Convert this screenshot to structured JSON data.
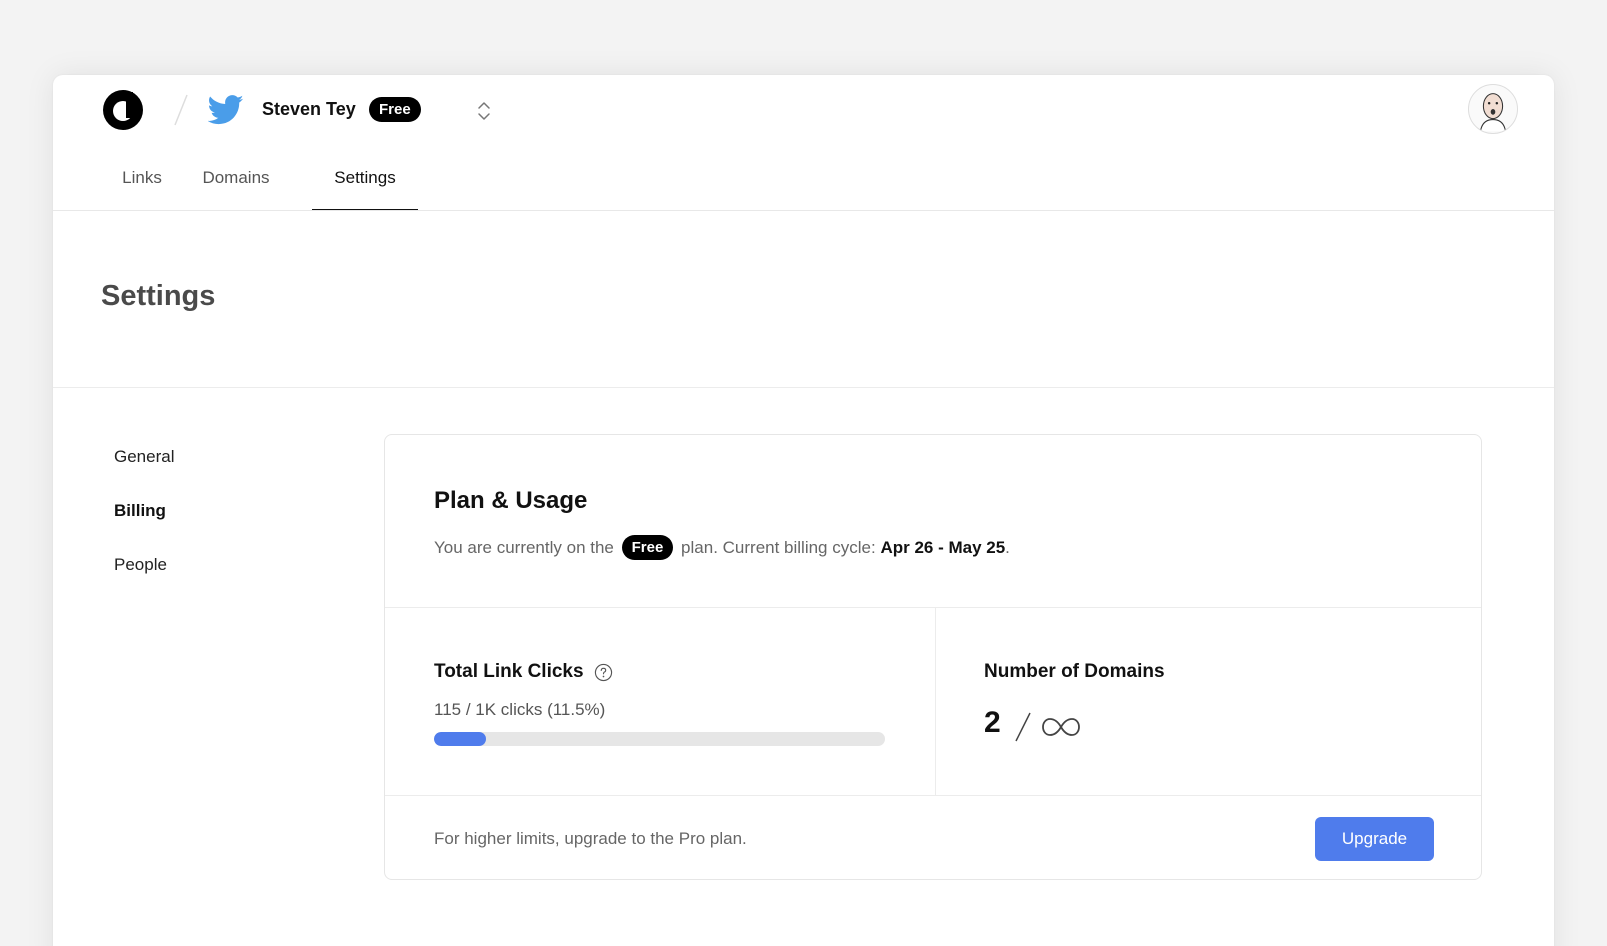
{
  "header": {
    "account_name": "Steven Tey",
    "plan_badge": "Free",
    "logo_icon": "brand-logo-icon",
    "account_icon": "twitter-bird-icon",
    "switcher_icon": "chevron-up-down-icon",
    "avatar_icon": "user-avatar"
  },
  "tabs": [
    {
      "label": "Links"
    },
    {
      "label": "Domains"
    },
    {
      "label": "Settings",
      "active": true
    }
  ],
  "page": {
    "title": "Settings"
  },
  "sidenav": {
    "items": [
      {
        "label": "General"
      },
      {
        "label": "Billing",
        "active": true
      },
      {
        "label": "People"
      }
    ]
  },
  "plan_card": {
    "title": "Plan & Usage",
    "sub_prefix": "You are currently on the",
    "plan_badge": "Free",
    "sub_middle": "plan. Current billing cycle:",
    "billing_cycle": "Apr 26 - May 25",
    "sub_suffix": ".",
    "clicks": {
      "title": "Total Link Clicks",
      "usage_text": "115 / 1K clicks (11.5%)",
      "used": 115,
      "limit": 1000,
      "progress_fraction": 0.115
    },
    "domains": {
      "title": "Number of Domains",
      "count": "2",
      "limit_icon": "infinity-icon"
    },
    "footer_text": "For higher limits, upgrade to the Pro plan.",
    "upgrade_label": "Upgrade"
  },
  "colors": {
    "accent": "#4f7cec",
    "twitter_blue": "#4a9de9",
    "badge_bg": "#000000"
  }
}
